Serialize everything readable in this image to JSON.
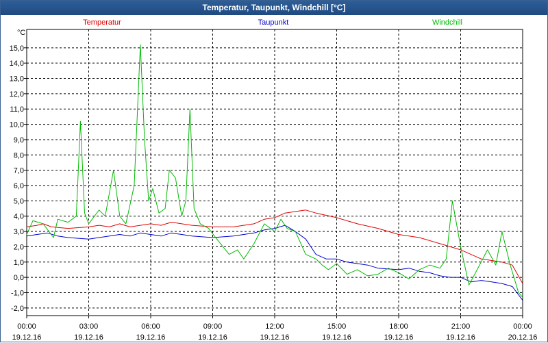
{
  "window": {
    "title": "Temperatur, Taupunkt, Windchill [°C]"
  },
  "chart_data": {
    "type": "line",
    "ylabel": "°C",
    "ylim": [
      -2.5,
      16.2
    ],
    "yticks": [
      "15,0",
      "14,0",
      "13,0",
      "12,0",
      "11,0",
      "10,0",
      "9,0",
      "8,0",
      "7,0",
      "6,0",
      "5,0",
      "4,0",
      "3,0",
      "2,0",
      "1,0",
      "0,0",
      "-1,0",
      "-2,0"
    ],
    "ytick_values": [
      15,
      14,
      13,
      12,
      11,
      10,
      9,
      8,
      7,
      6,
      5,
      4,
      3,
      2,
      1,
      0,
      -1,
      -2
    ],
    "xlim": [
      0,
      24
    ],
    "xticks": [
      {
        "x": 0,
        "time": "00:00",
        "date": "19.12.16"
      },
      {
        "x": 3,
        "time": "03:00",
        "date": "19.12.16"
      },
      {
        "x": 6,
        "time": "06:00",
        "date": "19.12.16"
      },
      {
        "x": 9,
        "time": "09:00",
        "date": "19.12.16"
      },
      {
        "x": 12,
        "time": "12:00",
        "date": "19.12.16"
      },
      {
        "x": 15,
        "time": "15:00",
        "date": "19.12.16"
      },
      {
        "x": 18,
        "time": "18:00",
        "date": "19.12.16"
      },
      {
        "x": 21,
        "time": "21:00",
        "date": "19.12.16"
      },
      {
        "x": 24,
        "time": "00:00",
        "date": "20.12.16"
      }
    ],
    "grid": true,
    "series": [
      {
        "name": "Temperatur",
        "color": "#e00000",
        "points": [
          [
            0,
            3.3
          ],
          [
            0.5,
            3.4
          ],
          [
            0.8,
            3.5
          ],
          [
            1.2,
            3.3
          ],
          [
            2,
            3.2
          ],
          [
            3,
            3.3
          ],
          [
            3.5,
            3.4
          ],
          [
            4,
            3.3
          ],
          [
            4.5,
            3.5
          ],
          [
            5,
            3.3
          ],
          [
            5.5,
            3.4
          ],
          [
            6,
            3.5
          ],
          [
            6.5,
            3.4
          ],
          [
            7,
            3.6
          ],
          [
            7.5,
            3.5
          ],
          [
            8,
            3.4
          ],
          [
            9,
            3.3
          ],
          [
            10,
            3.3
          ],
          [
            11,
            3.5
          ],
          [
            11.5,
            3.8
          ],
          [
            12,
            3.9
          ],
          [
            12.5,
            4.2
          ],
          [
            13,
            4.3
          ],
          [
            13.5,
            4.4
          ],
          [
            14,
            4.2
          ],
          [
            15,
            3.9
          ],
          [
            16,
            3.5
          ],
          [
            17,
            3.2
          ],
          [
            18,
            2.8
          ],
          [
            19,
            2.6
          ],
          [
            20,
            2.2
          ],
          [
            20.5,
            2.0
          ],
          [
            21,
            1.8
          ],
          [
            21.5,
            1.5
          ],
          [
            22,
            1.2
          ],
          [
            22.5,
            1.1
          ],
          [
            23,
            1.0
          ],
          [
            23.5,
            0.8
          ],
          [
            24,
            -0.4
          ]
        ]
      },
      {
        "name": "Taupunkt",
        "color": "#0000cc",
        "points": [
          [
            0,
            2.7
          ],
          [
            0.5,
            2.8
          ],
          [
            1,
            2.9
          ],
          [
            1.5,
            2.7
          ],
          [
            2,
            2.6
          ],
          [
            3,
            2.5
          ],
          [
            3.5,
            2.6
          ],
          [
            4,
            2.7
          ],
          [
            4.5,
            2.8
          ],
          [
            5,
            2.7
          ],
          [
            5.5,
            2.9
          ],
          [
            6,
            2.8
          ],
          [
            6.5,
            2.7
          ],
          [
            7,
            2.9
          ],
          [
            7.5,
            2.8
          ],
          [
            8,
            2.7
          ],
          [
            9,
            2.6
          ],
          [
            10,
            2.7
          ],
          [
            11,
            2.9
          ],
          [
            11.5,
            3.1
          ],
          [
            12,
            3.2
          ],
          [
            12.5,
            3.4
          ],
          [
            13,
            3.0
          ],
          [
            13.5,
            2.5
          ],
          [
            14,
            1.5
          ],
          [
            14.5,
            1.2
          ],
          [
            15,
            1.2
          ],
          [
            15.5,
            1.0
          ],
          [
            16,
            0.9
          ],
          [
            16.5,
            0.8
          ],
          [
            17,
            0.6
          ],
          [
            18,
            0.5
          ],
          [
            18.5,
            0.6
          ],
          [
            19,
            0.4
          ],
          [
            19.5,
            0.3
          ],
          [
            20,
            0.1
          ],
          [
            20.5,
            0.0
          ],
          [
            21,
            0.0
          ],
          [
            21.5,
            -0.3
          ],
          [
            22,
            -0.2
          ],
          [
            22.5,
            -0.3
          ],
          [
            23,
            -0.4
          ],
          [
            23.5,
            -0.6
          ],
          [
            24,
            -1.5
          ]
        ]
      },
      {
        "name": "Windchill",
        "color": "#00bb00",
        "points": [
          [
            0,
            2.8
          ],
          [
            0.3,
            3.7
          ],
          [
            0.8,
            3.5
          ],
          [
            1.3,
            2.6
          ],
          [
            1.5,
            3.8
          ],
          [
            2,
            3.6
          ],
          [
            2.4,
            4.0
          ],
          [
            2.6,
            10.2
          ],
          [
            2.8,
            4.2
          ],
          [
            3.0,
            3.5
          ],
          [
            3.5,
            4.4
          ],
          [
            3.8,
            4.0
          ],
          [
            4.2,
            7.0
          ],
          [
            4.5,
            4.0
          ],
          [
            4.8,
            3.5
          ],
          [
            5.2,
            6.0
          ],
          [
            5.5,
            15.2
          ],
          [
            5.7,
            9.0
          ],
          [
            5.9,
            5.0
          ],
          [
            6.1,
            5.8
          ],
          [
            6.4,
            4.2
          ],
          [
            6.7,
            4.5
          ],
          [
            6.9,
            7.0
          ],
          [
            7.2,
            6.5
          ],
          [
            7.5,
            4.0
          ],
          [
            7.7,
            5.0
          ],
          [
            7.9,
            11.0
          ],
          [
            8.1,
            4.5
          ],
          [
            8.4,
            3.5
          ],
          [
            8.8,
            3.2
          ],
          [
            9.2,
            2.5
          ],
          [
            9.5,
            2.0
          ],
          [
            9.8,
            1.5
          ],
          [
            10.2,
            1.8
          ],
          [
            10.5,
            1.2
          ],
          [
            11,
            2.2
          ],
          [
            11.5,
            3.5
          ],
          [
            12,
            3.0
          ],
          [
            12.3,
            3.8
          ],
          [
            12.6,
            3.2
          ],
          [
            13,
            3.0
          ],
          [
            13.5,
            1.5
          ],
          [
            14,
            1.2
          ],
          [
            14.3,
            0.8
          ],
          [
            14.6,
            0.5
          ],
          [
            15,
            0.9
          ],
          [
            15.5,
            0.2
          ],
          [
            16,
            0.5
          ],
          [
            16.5,
            0.1
          ],
          [
            17,
            0.2
          ],
          [
            17.5,
            0.6
          ],
          [
            18,
            0.3
          ],
          [
            18.5,
            -0.1
          ],
          [
            19,
            0.5
          ],
          [
            19.5,
            0.8
          ],
          [
            20,
            0.6
          ],
          [
            20.3,
            1.2
          ],
          [
            20.6,
            5.0
          ],
          [
            21,
            2.0
          ],
          [
            21.4,
            -0.5
          ],
          [
            21.8,
            0.5
          ],
          [
            22.3,
            1.8
          ],
          [
            22.7,
            0.8
          ],
          [
            23,
            3.0
          ],
          [
            23.4,
            0.8
          ],
          [
            23.8,
            -1.0
          ],
          [
            24,
            -1.3
          ]
        ]
      }
    ]
  }
}
